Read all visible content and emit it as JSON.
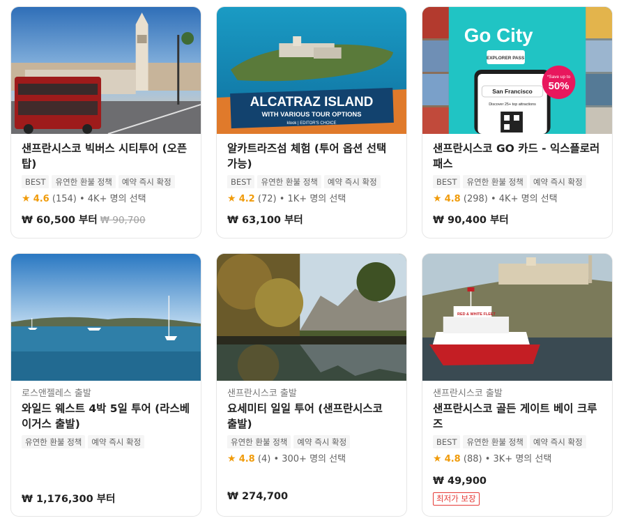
{
  "currency": "₩",
  "cards": [
    {
      "origin": "",
      "title": "샌프란시스코 빅버스 시티투어 (오픈탑)",
      "tags": [
        "BEST",
        "유연한 환불 정책",
        "예약 즉시 확정"
      ],
      "score": "4.6",
      "reviews": "(154)",
      "booked": "• 4K+ 명의 선택",
      "price": "₩ 60,500 부터",
      "old_price": "₩ 90,700",
      "image_caption": "",
      "badge": ""
    },
    {
      "origin": "",
      "title": "알카트라즈섬 체험 (투어 옵션 선택 가능)",
      "tags": [
        "BEST",
        "유연한 환불 정책",
        "예약 즉시 확정"
      ],
      "score": "4.2",
      "reviews": "(72)",
      "booked": "• 1K+ 명의 선택",
      "price": "₩ 63,100 부터",
      "old_price": "",
      "image_caption": "ALCATRAZ ISLAND",
      "image_subcaption": "WITH VARIOUS TOUR OPTIONS",
      "image_tagline": "klook | EDITOR'S CHOICE",
      "badge": ""
    },
    {
      "origin": "",
      "title": "샌프란시스코 GO 카드 - 익스플로러 패스",
      "tags": [
        "BEST",
        "유연한 환불 정책",
        "예약 즉시 확정"
      ],
      "score": "4.8",
      "reviews": "(298)",
      "booked": "• 4K+ 명의 선택",
      "price": "₩ 90,400 부터",
      "old_price": "",
      "image_caption": "Go City",
      "image_pass": "EXPLORER PASS",
      "image_save": "*Save up to",
      "image_percent": "50%",
      "image_city": "San Francisco",
      "image_discover": "Discover 25+ top attractions",
      "badge": ""
    },
    {
      "origin": "로스앤젤레스 출발",
      "title": "와일드 웨스트 4박 5일 투어 (라스베이거스 출발)",
      "tags": [
        "유연한 환불 정책",
        "예약 즉시 확정"
      ],
      "score": "",
      "reviews": "",
      "booked": "",
      "price": "₩ 1,176,300 부터",
      "old_price": "",
      "badge": ""
    },
    {
      "origin": "샌프란시스코 출발",
      "title": "요세미티 일일 투어 (샌프란시스코 출발)",
      "tags": [
        "유연한 환불 정책",
        "예약 즉시 확정"
      ],
      "score": "4.8",
      "reviews": "(4)",
      "booked": "• 300+ 명의 선택",
      "price": "₩ 274,700",
      "old_price": "",
      "badge": ""
    },
    {
      "origin": "샌프란시스코 출발",
      "title": "샌프란시스코 골든 게이트 베이 크루즈",
      "tags": [
        "BEST",
        "유연한 환불 정책",
        "예약 즉시 확정"
      ],
      "score": "4.8",
      "reviews": "(88)",
      "booked": "• 3K+ 명의 선택",
      "price": "₩ 49,900",
      "old_price": "",
      "image_caption": "RED & WHITE FLEET",
      "badge": "최저가 보장"
    }
  ],
  "colors": {
    "star": "#f09b0a",
    "badge": "#e53935",
    "tag_bg": "#f5f5f5"
  }
}
